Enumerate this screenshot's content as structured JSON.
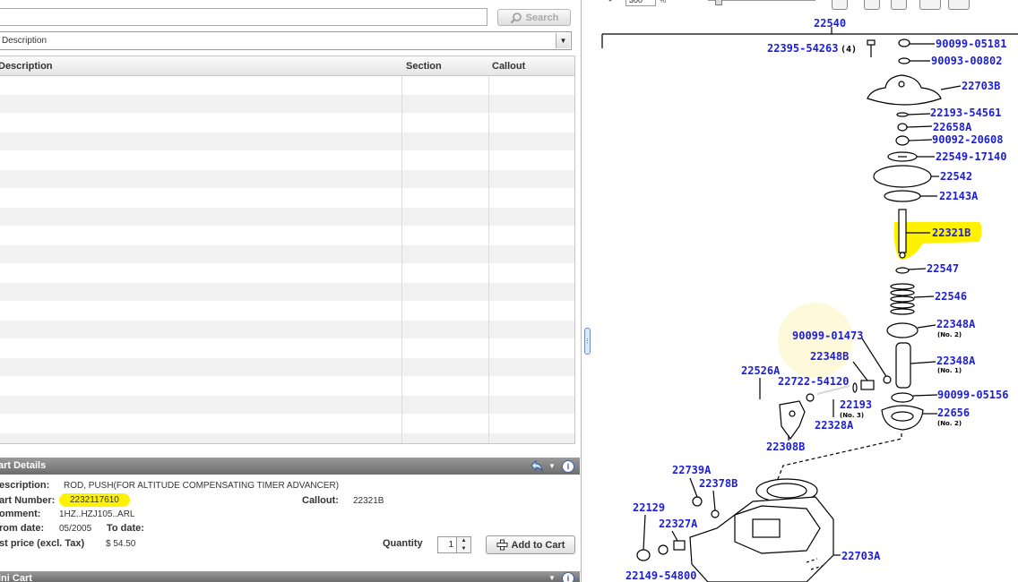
{
  "search": {
    "button_label": "Search",
    "value": ""
  },
  "filter": {
    "selected": "Description"
  },
  "grid": {
    "columns": [
      "Description",
      "Section",
      "Callout"
    ],
    "rows": [
      {},
      {},
      {},
      {},
      {},
      {},
      {},
      {},
      {},
      {},
      {},
      {},
      {},
      {},
      {},
      {},
      {},
      {},
      {},
      {},
      {}
    ]
  },
  "part_details": {
    "panel_title": "art Details",
    "description_label": "escription:",
    "description_value": "ROD, PUSH(FOR ALTITUDE COMPENSATING TIMER ADVANCER)",
    "part_number_label": "art Number:",
    "part_number_value": "2232117610",
    "callout_label": "Callout:",
    "callout_value": "22321B",
    "comment_label": "omment:",
    "comment_value": "1HZ..HZJ105..ARL",
    "from_date_label": "rom date:",
    "from_date_value": "05/2005",
    "to_date_label": "To date:",
    "to_date_value": "",
    "list_price_label": "st price (excl. Tax)",
    "list_price_value": "$ 54.50",
    "quantity_label": "Quantity",
    "quantity_value": "1",
    "add_to_cart_label": "Add to Cart"
  },
  "mini_cart": {
    "panel_title": "ini Cart"
  },
  "diagram": {
    "zoom_value": "300",
    "labels": {
      "l22540": "22540",
      "l2239554263": "22395-54263",
      "l2239554263q": "(4)",
      "l9009905181": "90099-05181",
      "l9009300802": "90093-00802",
      "l22703B": "22703B",
      "l2219354561": "22193-54561",
      "l22658A": "22658A",
      "l9009220608": "90092-20608",
      "l2254917140": "22549-17140",
      "l22542": "22542",
      "l22143A": "22143A",
      "l22321B": "22321B",
      "l22547": "22547",
      "l22546": "22546",
      "l22348A1": "22348A",
      "l22348A1s": "(No. 2)",
      "l9009901473": "90099-01473",
      "l22348B": "22348B",
      "l22348A2": "22348A",
      "l22348A2s": "(No. 1)",
      "l22526A": "22526A",
      "l2272254120": "22722-54120",
      "l9009905156": "90099-05156",
      "l22193": "22193",
      "l22193s": "(No. 3)",
      "l22656": "22656",
      "l22656s": "(No. 2)",
      "l22328A": "22328A",
      "l22308B": "22308B",
      "l22739A": "22739A",
      "l22378B": "22378B",
      "l22129": "22129",
      "l22327A": "22327A",
      "l22703A": "22703A",
      "l2214954800": "22149-54800"
    }
  },
  "colors": {
    "link_blue": "#1c1fd6",
    "highlight_yellow": "#fff200",
    "toolbar_gray": "#7f7f7f"
  },
  "icons": [
    "magnifier-icon",
    "dropdown-arrow-icon",
    "back-arrow-icon",
    "chevron-down-icon",
    "help-icon",
    "add-cart-icon",
    "splitter-handle-icon"
  ]
}
